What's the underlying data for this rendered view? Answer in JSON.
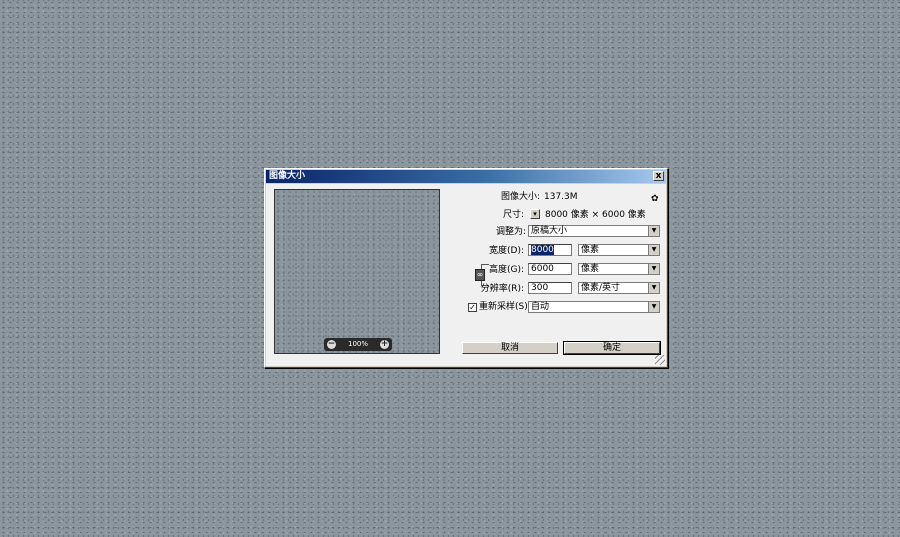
{
  "dialog": {
    "title": "图像大小",
    "close_label": "x"
  },
  "preview": {
    "zoom_out": "−",
    "zoom_level": "100%",
    "zoom_in": "+"
  },
  "image_size": {
    "label": "图像大小:",
    "value": "137.3M"
  },
  "dimensions": {
    "label": "尺寸:",
    "dropdown": "▾",
    "value": "8000 像素  ×  6000 像素"
  },
  "fit_to": {
    "label": "调整为:",
    "value": "原稿大小"
  },
  "width": {
    "label": "宽度(D):",
    "value": "8000",
    "unit": "像素"
  },
  "height": {
    "label": "高度(G):",
    "value": "6000",
    "unit": "像素"
  },
  "resolution": {
    "label": "分辨率(R):",
    "value": "300",
    "unit": "像素/英寸"
  },
  "resample": {
    "checked": "✓",
    "label": "重新采样(S):",
    "value": "自动"
  },
  "buttons": {
    "cancel": "取消",
    "ok": "确定"
  },
  "icons": {
    "gear": "✿",
    "link": "∞",
    "arrow": "▼"
  }
}
